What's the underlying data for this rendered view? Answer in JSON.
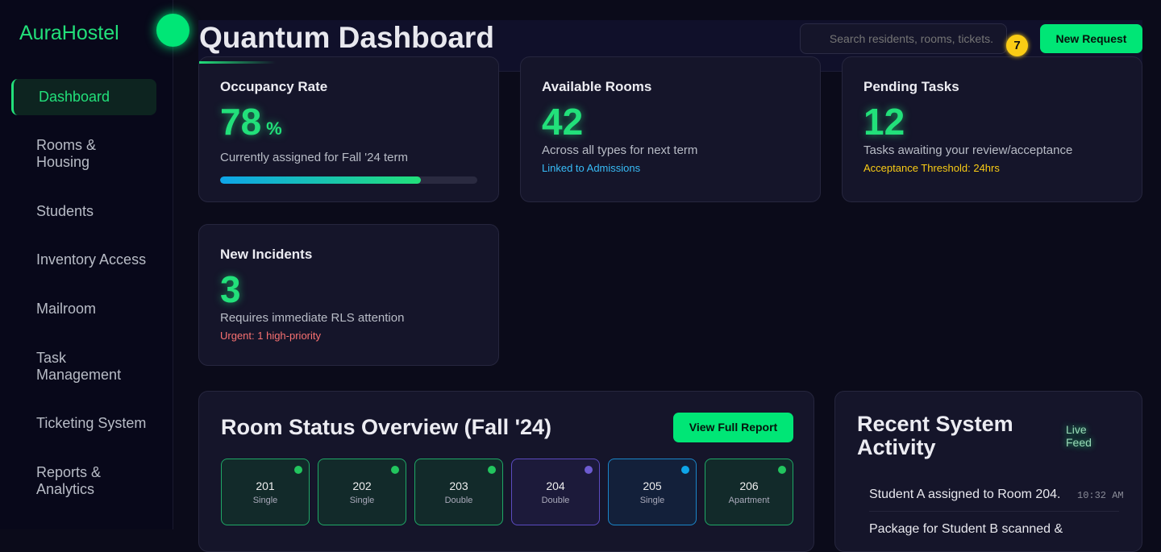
{
  "sidebar": {
    "logo": "AuraHostel",
    "items": [
      {
        "label": "Dashboard",
        "active": true
      },
      {
        "label": "Rooms & Housing"
      },
      {
        "label": "Students"
      },
      {
        "label": "Inventory Access"
      },
      {
        "label": "Mailroom"
      },
      {
        "label": "Task Management"
      },
      {
        "label": "Ticketing System"
      },
      {
        "label": "Reports & Analytics"
      }
    ]
  },
  "header": {
    "title": "Quantum Dashboard",
    "search_placeholder": "Search residents, rooms, tickets.",
    "notification_count": "7",
    "new_request": "New Request"
  },
  "stats": [
    {
      "title": "Occupancy Rate",
      "value": "78",
      "unit": "%",
      "sub": "Currently assigned for Fall '24 term",
      "progress": 78
    },
    {
      "title": "Available Rooms",
      "value": "42",
      "sub": "Across all types for next term",
      "note": "Linked to Admissions",
      "note_color": "#38bdf8"
    },
    {
      "title": "Pending Tasks",
      "value": "12",
      "sub": "Tasks awaiting your review/acceptance",
      "note": "Acceptance Threshold: 24hrs",
      "note_color": "#facc15"
    },
    {
      "title": "New Incidents",
      "value": "3",
      "sub": "Requires immediate RLS attention",
      "note": "Urgent: 1 high-priority",
      "note_color": "#f87171"
    }
  ],
  "room_status": {
    "title": "Room Status Overview (Fall '24)",
    "button": "View Full Report",
    "rooms": [
      {
        "number": "201",
        "type": "Single",
        "status_color": "#22c55e"
      },
      {
        "number": "202",
        "type": "Single",
        "status_color": "#22c55e"
      },
      {
        "number": "203",
        "type": "Double",
        "status_color": "#22c55e"
      },
      {
        "number": "204",
        "type": "Double",
        "status_color": "#6d5bd0"
      },
      {
        "number": "205",
        "type": "Single",
        "status_color": "#0ea5e9"
      },
      {
        "number": "206",
        "type": "Apartment",
        "status_color": "#22c55e"
      }
    ]
  },
  "activity": {
    "title": "Recent System Activity",
    "live": "Live Feed",
    "items": [
      {
        "text": "Student A assigned to Room 204.",
        "time": "10:32 AM"
      },
      {
        "text": "Package for Student B scanned &"
      }
    ]
  }
}
